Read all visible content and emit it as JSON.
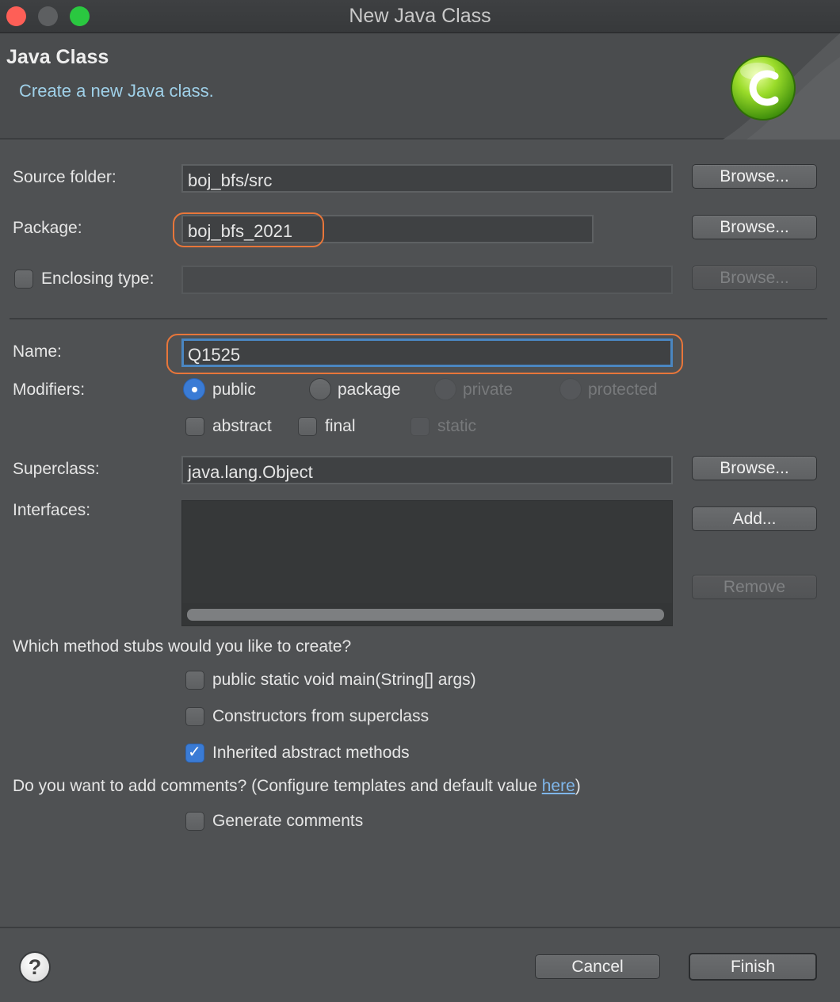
{
  "window": {
    "title": "New Java Class"
  },
  "banner": {
    "title": "Java Class",
    "subtitle": "Create a new Java class.",
    "icon": "java-class-c-icon"
  },
  "form": {
    "source_folder": {
      "label": "Source folder:",
      "value": "boj_bfs/src",
      "browse": "Browse..."
    },
    "package": {
      "label": "Package:",
      "value": "boj_bfs_2021",
      "browse": "Browse..."
    },
    "enclosing_type": {
      "label": "Enclosing type:",
      "value": "",
      "browse": "Browse...",
      "checked": false
    },
    "name": {
      "label": "Name:",
      "value": "Q1525"
    },
    "modifiers": {
      "label": "Modifiers:",
      "access": [
        {
          "label": "public",
          "selected": true,
          "enabled": true
        },
        {
          "label": "package",
          "selected": false,
          "enabled": true
        },
        {
          "label": "private",
          "selected": false,
          "enabled": false
        },
        {
          "label": "protected",
          "selected": false,
          "enabled": false
        }
      ],
      "flags": [
        {
          "label": "abstract",
          "checked": false,
          "enabled": true
        },
        {
          "label": "final",
          "checked": false,
          "enabled": true
        },
        {
          "label": "static",
          "checked": false,
          "enabled": false
        }
      ]
    },
    "superclass": {
      "label": "Superclass:",
      "value": "java.lang.Object",
      "browse": "Browse..."
    },
    "interfaces": {
      "label": "Interfaces:",
      "add": "Add...",
      "remove": "Remove"
    }
  },
  "stubs": {
    "question": "Which method stubs would you like to create?",
    "options": [
      {
        "label": "public static void main(String[] args)",
        "checked": false
      },
      {
        "label": "Constructors from superclass",
        "checked": false
      },
      {
        "label": "Inherited abstract methods",
        "checked": true
      }
    ]
  },
  "comments": {
    "question_prefix": "Do you want to add comments? (Configure templates and default value ",
    "link": "here",
    "question_suffix": ")",
    "generate": {
      "label": "Generate comments",
      "checked": false
    }
  },
  "footer": {
    "help": "?",
    "cancel": "Cancel",
    "finish": "Finish"
  },
  "colors": {
    "highlight": "#e8763a",
    "accent": "#3a7bd5",
    "link": "#7fb6ea",
    "subtitle": "#9fd0e8"
  }
}
